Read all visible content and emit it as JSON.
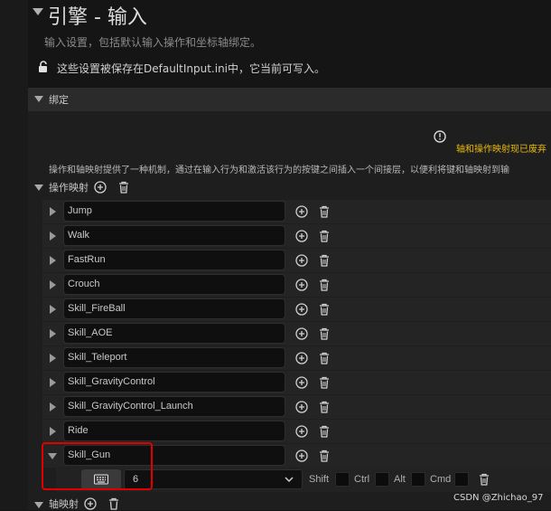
{
  "header": {
    "title": "引擎 - 输入",
    "subtitle": "输入设置，包括默认输入操作和坐标轴绑定。",
    "lock_text": "这些设置被保存在DefaultInput.ini中，它当前可写入。"
  },
  "bindings": {
    "section_label": "绑定",
    "warning": "轴和操作映射现已废弃",
    "description": "操作和轴映射提供了一种机制，通过在输入行为和激活该行为的按键之间插入一个间接层，以便利将键和轴映射到输",
    "action_mappings_label": "操作映射",
    "action_mappings": [
      {
        "name": "Jump"
      },
      {
        "name": "Walk"
      },
      {
        "name": "FastRun"
      },
      {
        "name": "Crouch"
      },
      {
        "name": "Skill_FireBall"
      },
      {
        "name": "Skill_AOE"
      },
      {
        "name": "Skill_Teleport"
      },
      {
        "name": "Skill_GravityControl"
      },
      {
        "name": "Skill_GravityControl_Launch"
      },
      {
        "name": "Ride"
      },
      {
        "name": "Skill_Gun"
      }
    ],
    "expanded_key": {
      "key_value": "6",
      "modifiers": [
        "Shift",
        "Ctrl",
        "Alt",
        "Cmd"
      ]
    },
    "axis_mappings_label": "轴映射"
  },
  "watermark": "CSDN @Zhichao_97",
  "colors": {
    "warning": "#e8b90c",
    "highlight_box": "#e00000",
    "background": "#151515"
  },
  "icons": [
    "lock-icon",
    "warning-icon",
    "plus-circle-icon",
    "trash-icon",
    "keyboard-icon",
    "chevron-down-icon"
  ]
}
